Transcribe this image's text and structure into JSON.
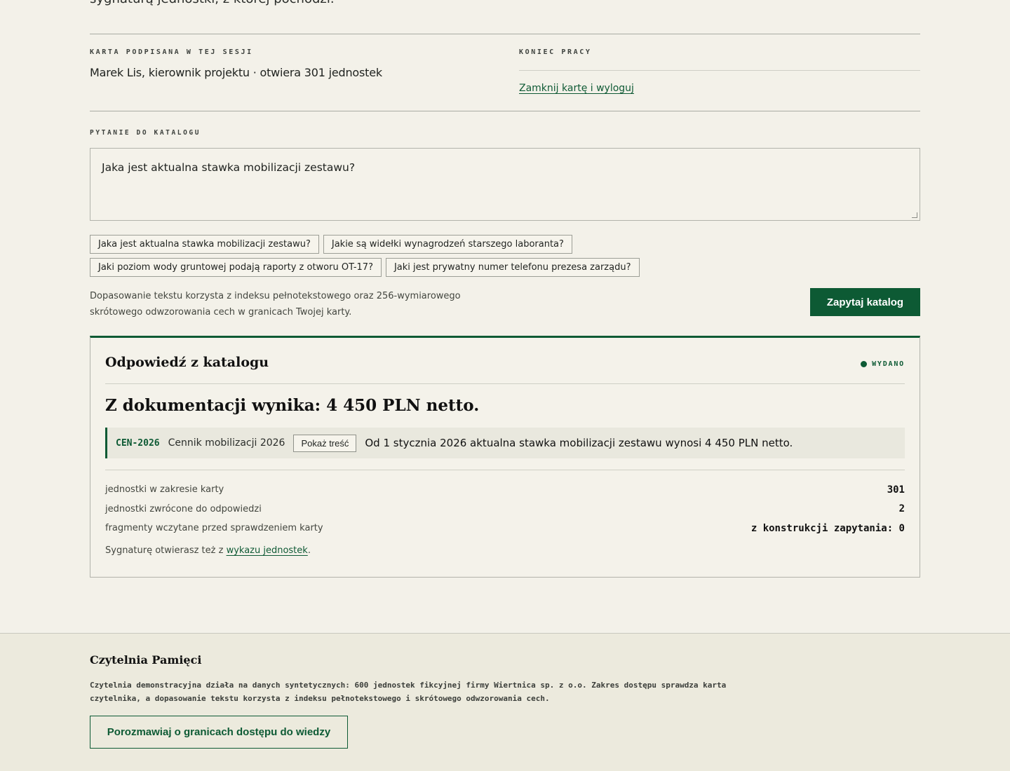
{
  "top_fragment": "sygnaturą jednostki, z której pochodzi.",
  "session": {
    "card_label": "KARTA PODPISANA W TEJ SESJI",
    "card_value": "Marek Lis, kierownik projektu · otwiera 301 jednostek",
    "end_label": "KONIEC PRACY",
    "logout_link": "Zamknij kartę i wyloguj"
  },
  "query": {
    "label": "PYTANIE DO KATALOGU",
    "value": "Jaka jest aktualna stawka mobilizacji zestawu?",
    "suggestions": [
      "Jaka jest aktualna stawka mobilizacji zestawu?",
      "Jakie są widełki wynagrodzeń starszego laboranta?",
      "Jaki poziom wody gruntowej podają raporty z otworu OT-17?",
      "Jaki jest prywatny numer telefonu prezesa zarządu?"
    ],
    "note_line1": "Dopasowanie tekstu korzysta z indeksu pełnotekstowego oraz 256-wymiarowego",
    "note_line2": "skrótowego odwzorowania cech w granicach Twojej karty.",
    "submit": "Zapytaj katalog"
  },
  "answer": {
    "title": "Odpowiedź z katalogu",
    "status": "WYDANO",
    "status_color": "#0d5a34",
    "headline": "Z dokumentacji wynika: 4 450 PLN netto.",
    "citation": {
      "code": "CEN-2026",
      "name": "Cennik mobilizacji 2026",
      "button": "Pokaż treść",
      "text": "Od 1 stycznia 2026 aktualna stawka mobilizacji zestawu wynosi 4 450 PLN netto."
    },
    "stats": [
      {
        "label": "jednostki w zakresie karty",
        "value": "301"
      },
      {
        "label": "jednostki zwrócone do odpowiedzi",
        "value": "2"
      },
      {
        "label": "fragmenty wczytane przed sprawdzeniem karty",
        "value": "z konstrukcji zapytania: 0"
      }
    ],
    "note_prefix": "Sygnaturę otwierasz też z ",
    "note_link": "wykazu jednostek",
    "note_suffix": "."
  },
  "footer": {
    "brand": "Czytelnia Pamięci",
    "desc_line1": "Czytelnia demonstracyjna działa na danych syntetycznych: 600 jednostek fikcyjnej firmy Wiertnica sp. z o.o. Zakres dostępu sprawdza karta",
    "desc_line2": "czytelnika, a dopasowanie tekstu korzysta z indeksu pełnotekstowego i skrótowego odwzorowania cech.",
    "cta": "Porozmawiaj o granicach dostępu do wiedzy"
  },
  "colors": {
    "accent": "#0d5a34",
    "background": "#f3f1e9",
    "footer_bg": "#eceadd"
  }
}
